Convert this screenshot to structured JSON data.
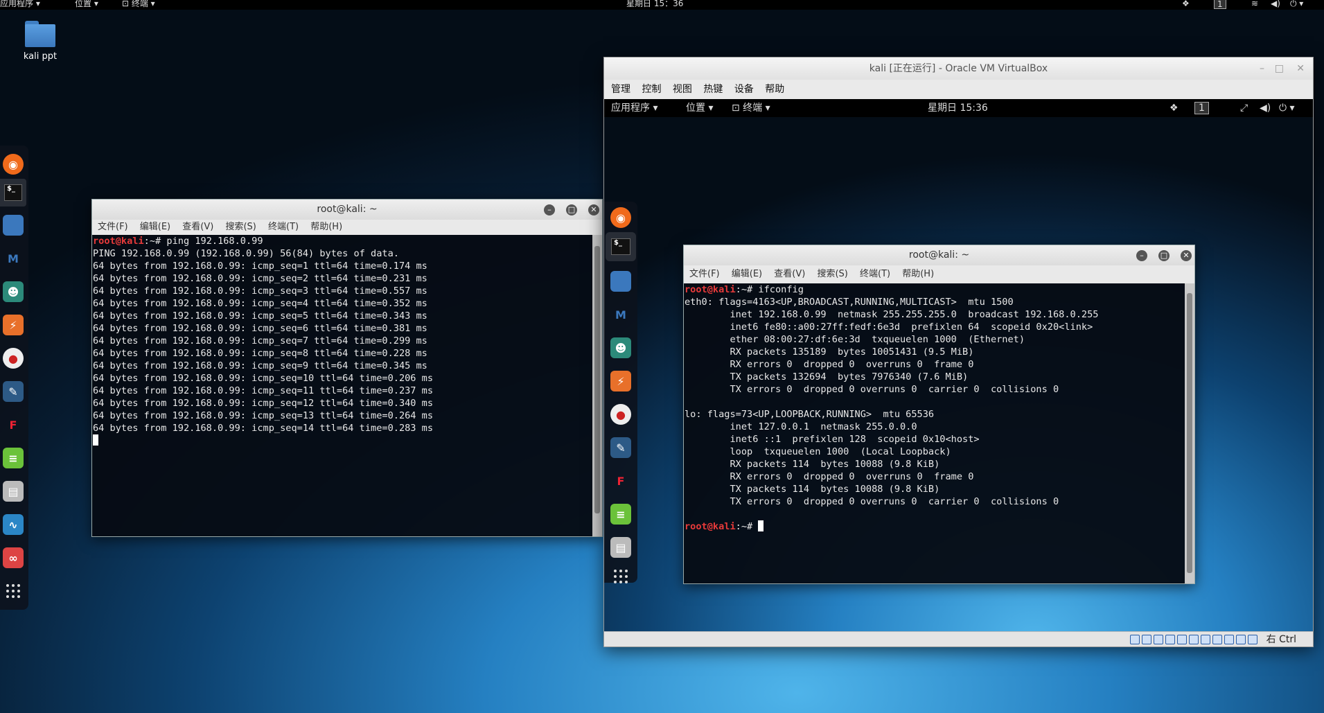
{
  "host_bar": {
    "applications": "应用程序 ▾",
    "places": "位置 ▾",
    "terminal": "⊡ 终端 ▾",
    "clock": "星期日 15：36",
    "workspace": "1"
  },
  "desktop": {
    "folder_label": "kali ppt"
  },
  "dock_items": [
    "firefox-icon",
    "terminal-icon",
    "files-icon",
    "metasploit-icon",
    "armitage-icon",
    "burpsuite-icon",
    "beef-icon",
    "faraday-icon",
    "maltego-icon",
    "notes-icon",
    "cherrytree-icon",
    "wireshark-icon",
    "zenmap-icon",
    "app-grid-icon"
  ],
  "terminal_left": {
    "title": "root@kali: ~",
    "menu": [
      "文件(F)",
      "编辑(E)",
      "查看(V)",
      "搜索(S)",
      "终端(T)",
      "帮助(H)"
    ],
    "prompt_user": "root@kali",
    "prompt_path": ":~# ping 192.168.0.99",
    "lines": [
      "PING 192.168.0.99 (192.168.0.99) 56(84) bytes of data.",
      "64 bytes from 192.168.0.99: icmp_seq=1 ttl=64 time=0.174 ms",
      "64 bytes from 192.168.0.99: icmp_seq=2 ttl=64 time=0.231 ms",
      "64 bytes from 192.168.0.99: icmp_seq=3 ttl=64 time=0.557 ms",
      "64 bytes from 192.168.0.99: icmp_seq=4 ttl=64 time=0.352 ms",
      "64 bytes from 192.168.0.99: icmp_seq=5 ttl=64 time=0.343 ms",
      "64 bytes from 192.168.0.99: icmp_seq=6 ttl=64 time=0.381 ms",
      "64 bytes from 192.168.0.99: icmp_seq=7 ttl=64 time=0.299 ms",
      "64 bytes from 192.168.0.99: icmp_seq=8 ttl=64 time=0.228 ms",
      "64 bytes from 192.168.0.99: icmp_seq=9 ttl=64 time=0.345 ms",
      "64 bytes from 192.168.0.99: icmp_seq=10 ttl=64 time=0.206 ms",
      "64 bytes from 192.168.0.99: icmp_seq=11 ttl=64 time=0.237 ms",
      "64 bytes from 192.168.0.99: icmp_seq=12 ttl=64 time=0.340 ms",
      "64 bytes from 192.168.0.99: icmp_seq=13 ttl=64 time=0.264 ms",
      "64 bytes from 192.168.0.99: icmp_seq=14 ttl=64 time=0.283 ms"
    ]
  },
  "vbox": {
    "title": "kali [正在运行] - Oracle VM VirtualBox",
    "menu": [
      "管理",
      "控制",
      "视图",
      "热键",
      "设备",
      "帮助"
    ],
    "status_hostkey": "右 Ctrl",
    "guest_bar": {
      "applications": "应用程序 ▾",
      "places": "位置 ▾",
      "terminal": "⊡ 终端 ▾",
      "clock": "星期日 15:36",
      "workspace": "1"
    },
    "terminal": {
      "title": "root@kali: ~",
      "menu": [
        "文件(F)",
        "编辑(E)",
        "查看(V)",
        "搜索(S)",
        "终端(T)",
        "帮助(H)"
      ],
      "prompt_user": "root@kali",
      "prompt_cmd": ":~# ifconfig",
      "prompt_end": ":~# ",
      "lines": [
        "eth0: flags=4163<UP,BROADCAST,RUNNING,MULTICAST>  mtu 1500",
        "        inet 192.168.0.99  netmask 255.255.255.0  broadcast 192.168.0.255",
        "        inet6 fe80::a00:27ff:fedf:6e3d  prefixlen 64  scopeid 0x20<link>",
        "        ether 08:00:27:df:6e:3d  txqueuelen 1000  (Ethernet)",
        "        RX packets 135189  bytes 10051431 (9.5 MiB)",
        "        RX errors 0  dropped 0  overruns 0  frame 0",
        "        TX packets 132694  bytes 7976340 (7.6 MiB)",
        "        TX errors 0  dropped 0 overruns 0  carrier 0  collisions 0",
        "",
        "lo: flags=73<UP,LOOPBACK,RUNNING>  mtu 65536",
        "        inet 127.0.0.1  netmask 255.0.0.0",
        "        inet6 ::1  prefixlen 128  scopeid 0x10<host>",
        "        loop  txqueuelen 1000  (Local Loopback)",
        "        RX packets 114  bytes 10088 (9.8 KiB)",
        "        RX errors 0  dropped 0  overruns 0  frame 0",
        "        TX packets 114  bytes 10088 (9.8 KiB)",
        "        TX errors 0  dropped 0 overruns 0  carrier 0  collisions 0",
        ""
      ]
    }
  }
}
